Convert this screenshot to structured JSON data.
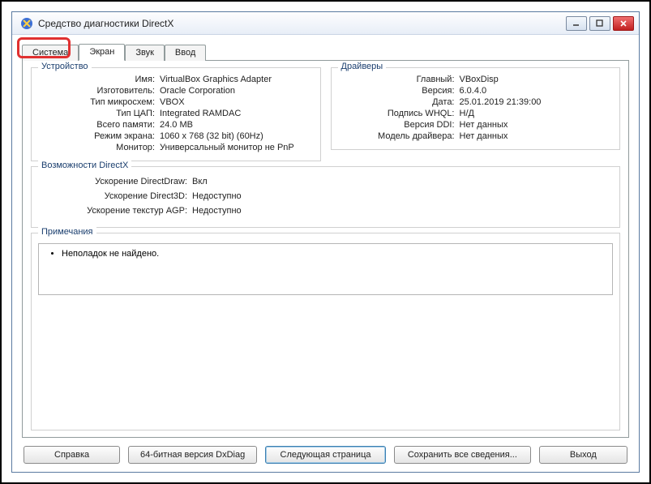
{
  "window": {
    "title": "Средство диагностики DirectX"
  },
  "tabs": [
    {
      "label": "Система"
    },
    {
      "label": "Экран"
    },
    {
      "label": "Звук"
    },
    {
      "label": "Ввод"
    }
  ],
  "device": {
    "legend": "Устройство",
    "rows": [
      {
        "label": "Имя:",
        "value": "VirtualBox Graphics Adapter"
      },
      {
        "label": "Изготовитель:",
        "value": "Oracle Corporation"
      },
      {
        "label": "Тип микросхем:",
        "value": "VBOX"
      },
      {
        "label": "Тип ЦАП:",
        "value": "Integrated RAMDAC"
      },
      {
        "label": "Всего памяти:",
        "value": "24.0 MB"
      },
      {
        "label": "Режим экрана:",
        "value": "1060 x 768 (32 bit) (60Hz)"
      },
      {
        "label": "Монитор:",
        "value": "Универсальный монитор не PnP"
      }
    ]
  },
  "drivers": {
    "legend": "Драйверы",
    "rows": [
      {
        "label": "Главный:",
        "value": "VBoxDisp"
      },
      {
        "label": "Версия:",
        "value": "6.0.4.0"
      },
      {
        "label": "Дата:",
        "value": "25.01.2019 21:39:00"
      },
      {
        "label": "Подпись WHQL:",
        "value": "Н/Д"
      },
      {
        "label": "Версия DDI:",
        "value": "Нет данных"
      },
      {
        "label": "Модель драйвера:",
        "value": "Нет данных"
      }
    ]
  },
  "features": {
    "legend": "Возможности DirectX",
    "rows": [
      {
        "label": "Ускорение DirectDraw:",
        "value": "Вкл"
      },
      {
        "label": "Ускорение Direct3D:",
        "value": "Недоступно"
      },
      {
        "label": "Ускорение текстур AGP:",
        "value": "Недоступно"
      }
    ]
  },
  "notes": {
    "legend": "Примечания",
    "item": "Неполадок не найдено."
  },
  "buttons": {
    "help": "Справка",
    "dxdiag64": "64-битная версия DxDiag",
    "next": "Следующая страница",
    "save": "Сохранить все сведения...",
    "exit": "Выход"
  }
}
